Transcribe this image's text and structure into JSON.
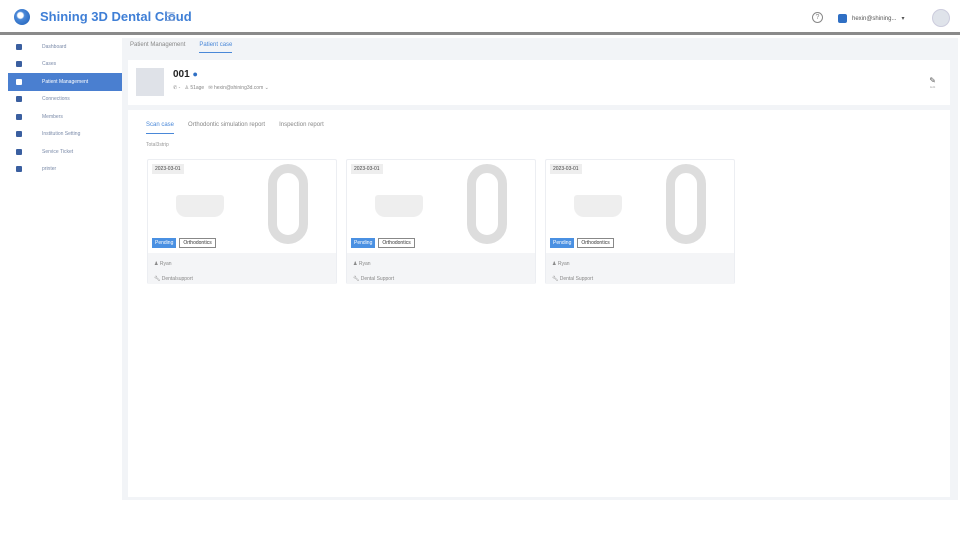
{
  "app": {
    "title": "Shining 3D Dental Cloud",
    "user": "hexin@shining...",
    "help": "?"
  },
  "sidebar": {
    "items": [
      {
        "label": "Dashboard"
      },
      {
        "label": "Cases"
      },
      {
        "label": "Patient Management",
        "active": true
      },
      {
        "label": "Connections"
      },
      {
        "label": "Members"
      },
      {
        "label": "Institution Setting"
      },
      {
        "label": "Service Ticket"
      },
      {
        "label": "printer"
      }
    ]
  },
  "breadcrumb": {
    "tabs": [
      "Patient Management",
      "Patient case"
    ]
  },
  "patient": {
    "id": "001",
    "phone": "-",
    "age": "51age",
    "email": "hexin@shining3d.com",
    "edit_label": "Edit"
  },
  "content": {
    "tabs": [
      "Scan case",
      "Orthodontic simulation report",
      "Inspection report"
    ],
    "total": "Total3strip",
    "cases": [
      {
        "date": "2023-03-01",
        "status": "Pending",
        "type": "Orthodontics",
        "doctor": "Ryan",
        "lab": "Dentalsupport"
      },
      {
        "date": "2023-03-01",
        "status": "Pending",
        "type": "Orthodontics",
        "doctor": "Ryan",
        "lab": "Dental Support"
      },
      {
        "date": "2023-03-01",
        "status": "Pending",
        "type": "Orthodontics",
        "doctor": "Ryan",
        "lab": "Dental Support"
      }
    ]
  }
}
